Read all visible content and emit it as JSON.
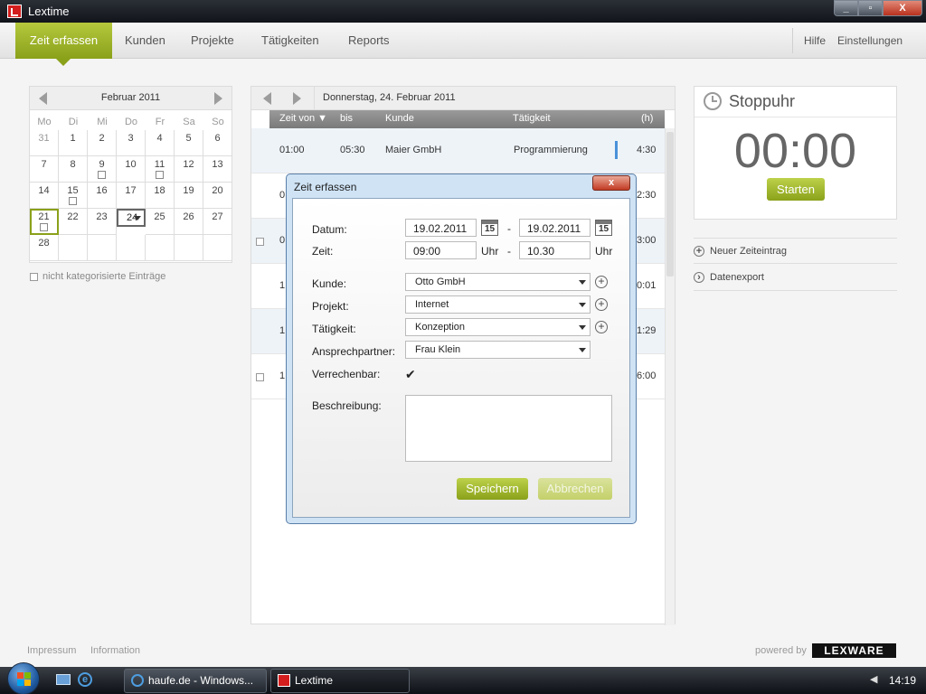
{
  "window": {
    "title": "Lextime",
    "min": "_",
    "max": "▫",
    "close": "X"
  },
  "nav": {
    "tabs": [
      "Zeit erfassen",
      "Kunden",
      "Projekte",
      "Tätigkeiten",
      "Reports"
    ],
    "hilfe": "Hilfe",
    "einstellungen": "Einstellungen"
  },
  "calendar": {
    "month": "Februar 2011",
    "weekdays": [
      "Mo",
      "Di",
      "Mi",
      "Do",
      "Fr",
      "Sa",
      "So"
    ],
    "days": [
      [
        "31",
        "1",
        "2",
        "3",
        "4",
        "5",
        "6"
      ],
      [
        "7",
        "8",
        "9",
        "10",
        "11",
        "12",
        "13"
      ],
      [
        "14",
        "15",
        "16",
        "17",
        "18",
        "19",
        "20"
      ],
      [
        "21",
        "22",
        "23",
        "24",
        "25",
        "26",
        "27"
      ],
      [
        "28",
        "",
        "",
        "",
        "",
        "",
        ""
      ]
    ],
    "uncategorized": "nicht kategorisierte Einträge"
  },
  "entries": {
    "date_header": "Donnerstag, 24. Februar 2011",
    "columns": [
      "Zeit von ▼",
      "bis",
      "Kunde",
      "Tätigkeit",
      "(h)"
    ],
    "rows": [
      {
        "von": "01:00",
        "bis": "05:30",
        "kunde": "Maier GmbH",
        "taetigkeit": "Programmierung",
        "h": "4:30"
      },
      {
        "von": "0",
        "bis": "",
        "kunde": "",
        "taetigkeit": "",
        "h": "2:30"
      },
      {
        "von": "0",
        "bis": "",
        "kunde": "",
        "taetigkeit": "",
        "h": "3:00"
      },
      {
        "von": "1",
        "bis": "",
        "kunde": "",
        "taetigkeit": "",
        "h": "0:01"
      },
      {
        "von": "1",
        "bis": "",
        "kunde": "",
        "taetigkeit": "",
        "h": "1:29"
      },
      {
        "von": "1",
        "bis": "",
        "kunde": "",
        "taetigkeit": "",
        "h": "6:00"
      }
    ]
  },
  "stopwatch": {
    "title": "Stoppuhr",
    "time": "00:00",
    "start": "Starten"
  },
  "actions": {
    "new_entry": "Neuer Zeiteintrag",
    "export": "Datenexport"
  },
  "footer": {
    "impressum": "Impressum",
    "information": "Information",
    "powered": "powered by",
    "brand": "LEXWARE"
  },
  "dialog": {
    "title": "Zeit erfassen",
    "close": "x",
    "datum_label": "Datum:",
    "datum_from": "19.02.2011",
    "datum_to": "19.02.2011",
    "dash": "-",
    "cal_day": "15",
    "zeit_label": "Zeit:",
    "zeit_from": "09:00",
    "zeit_to": "10.30",
    "uhr": "Uhr",
    "kunde_label": "Kunde:",
    "kunde": "Otto GmbH",
    "projekt_label": "Projekt:",
    "projekt": "Internet",
    "taetigkeit_label": "Tätigkeit:",
    "taetigkeit": "Konzeption",
    "ansprech_label": "Ansprechpartner:",
    "ansprech": "Frau Klein",
    "verrechenbar_label": "Verrechenbar:",
    "check": "✔",
    "beschreibung_label": "Beschreibung:",
    "save": "Speichern",
    "cancel": "Abbrechen"
  },
  "taskbar": {
    "task1": "haufe.de - Windows...",
    "task2": "Lextime",
    "clock": "14:19"
  }
}
